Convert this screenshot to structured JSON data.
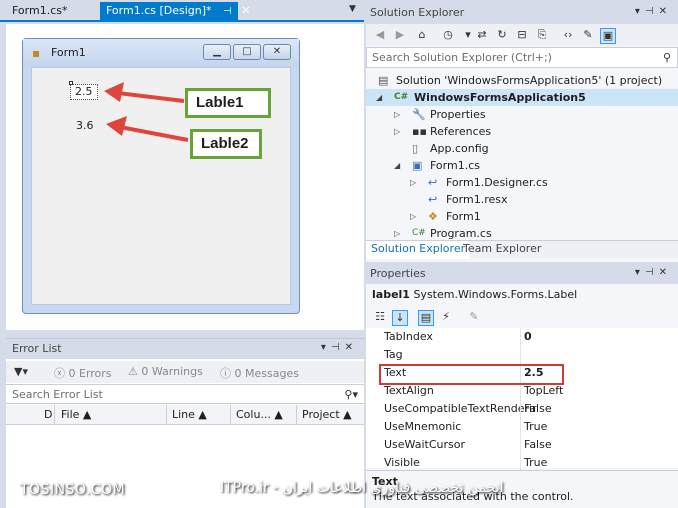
{
  "doc_tabs": {
    "inactive": "Form1.cs*",
    "active": "Form1.cs [Design]*",
    "pin_glyph": "⊣",
    "close_glyph": "✕"
  },
  "designer": {
    "form_title": "Form1",
    "label1_text": "2.5",
    "label2_text": "3.6",
    "callout1": "Lable1",
    "callout2": "Lable2",
    "annotation_color": "#e0453d",
    "callout_border_color": "#65a534"
  },
  "error_list": {
    "title": "Error List",
    "errors": "0 Errors",
    "warnings": "0 Warnings",
    "messages": "0 Messages",
    "search_placeholder": "Search Error List",
    "columns": [
      "D",
      "File",
      "Line",
      "Colu...",
      "Project"
    ]
  },
  "solution_explorer": {
    "title": "Solution Explorer",
    "search_placeholder": "Search Solution Explorer (Ctrl+;)",
    "tree": [
      {
        "label": "Solution 'WindowsFormsApplication5' (1 project)",
        "icon": "solution-icon"
      },
      {
        "label": "WindowsFormsApplication5",
        "icon": "csharp-project-icon"
      },
      {
        "label": "Properties",
        "icon": "wrench-icon"
      },
      {
        "label": "References",
        "icon": "references-icon"
      },
      {
        "label": "App.config",
        "icon": "config-file-icon"
      },
      {
        "label": "Form1.cs",
        "icon": "form-file-icon"
      },
      {
        "label": "Form1.Designer.cs",
        "icon": "cs-file-icon"
      },
      {
        "label": "Form1.resx",
        "icon": "resx-file-icon"
      },
      {
        "label": "Form1",
        "icon": "class-icon"
      },
      {
        "label": "Program.cs",
        "icon": "cs-file-icon"
      }
    ],
    "tabs": [
      "Solution Explorer",
      "Team Explorer"
    ]
  },
  "properties": {
    "title": "Properties",
    "object_name": "label1",
    "object_type": "System.Windows.Forms.Label",
    "rows": [
      {
        "name": "TabIndex",
        "value": "0"
      },
      {
        "name": "Tag",
        "value": ""
      },
      {
        "name": "Text",
        "value": "2.5"
      },
      {
        "name": "TextAlign",
        "value": "TopLeft"
      },
      {
        "name": "UseCompatibleTextRenderir",
        "value": "False"
      },
      {
        "name": "UseMnemonic",
        "value": "True"
      },
      {
        "name": "UseWaitCursor",
        "value": "False"
      },
      {
        "name": "Visible",
        "value": "True"
      }
    ],
    "desc_title": "Text",
    "desc_text": "The text associated with the control.",
    "highlight_color": "#d23a3a"
  },
  "watermark": {
    "left": "TOSINSO.COM",
    "right": "ITPro.ir - انجمن تخصصی فناوری اطلاعات ایران"
  },
  "colors": {
    "accent": "#007acc",
    "selection": "#cce4f7",
    "chrome": "#d6dbe9"
  }
}
